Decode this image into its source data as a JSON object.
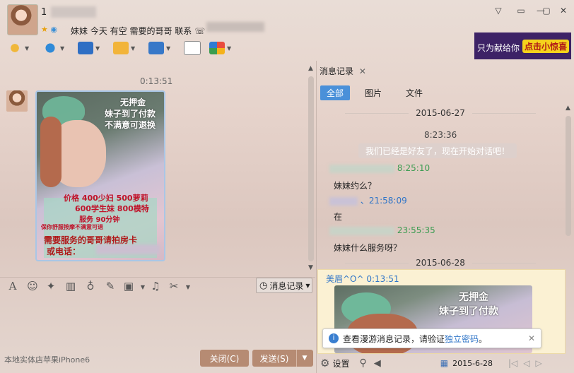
{
  "header": {
    "name_visible": "1",
    "signature": "妹妹  今天 有空  需要的哥哥  联系  ☏"
  },
  "window_controls": {
    "menu": "▽",
    "skin": "▭",
    "minimize": "—",
    "maximize": "▢",
    "close": "✕"
  },
  "ad": {
    "text": "只为献给你",
    "button": "点击小惊喜"
  },
  "chat": {
    "timestamp": "0:13:51",
    "image_texts": {
      "line1": "无押金",
      "line2": "妹子到了付款",
      "line3": "不满意可退换",
      "price1": "价格  400少妇  500萝莉",
      "price2": "600学生妹  800模特",
      "price3": "服务  90分钟",
      "small": "保你舒服按摩不满意可退",
      "contact1": "需要服务的哥哥请拍房卡",
      "contact2": "或电话："
    }
  },
  "input_toolbar": {
    "history_label": "消息记录"
  },
  "footer": {
    "text": "本地实体店苹果iPhone6",
    "close_label": "关闭(C)",
    "send_label": "发送(S)"
  },
  "panel": {
    "tab_label": "消息记录",
    "filter_tabs": [
      "全部",
      "图片",
      "文件"
    ],
    "entries": {
      "date1": "2015-06-27",
      "time1": "8:23:36",
      "system": "我们已经是好友了，现在开始对话吧！",
      "t_green1": "8:25:10",
      "msg1": "妹妹约么？",
      "t_blue1": "、21:58:09",
      "msg2": "在",
      "t_green2": "23:55:35",
      "msg3": "妹妹什么服务呀？",
      "date2": "2015-06-28",
      "highlight_sender": "美眉^O^ 0:13:51",
      "hl_line1": "无押金",
      "hl_line2": "妹子到了付款"
    },
    "notice": {
      "text": "查看漫游消息记录，请验证",
      "link": "独立密码",
      "suffix": "。"
    },
    "bottom": {
      "settings": "设置",
      "date": "2015-6-28"
    }
  },
  "colors": {
    "accent": "#4a90d9",
    "button": "#b68b73",
    "green": "#3c9c52",
    "blue": "#2f75c8"
  }
}
